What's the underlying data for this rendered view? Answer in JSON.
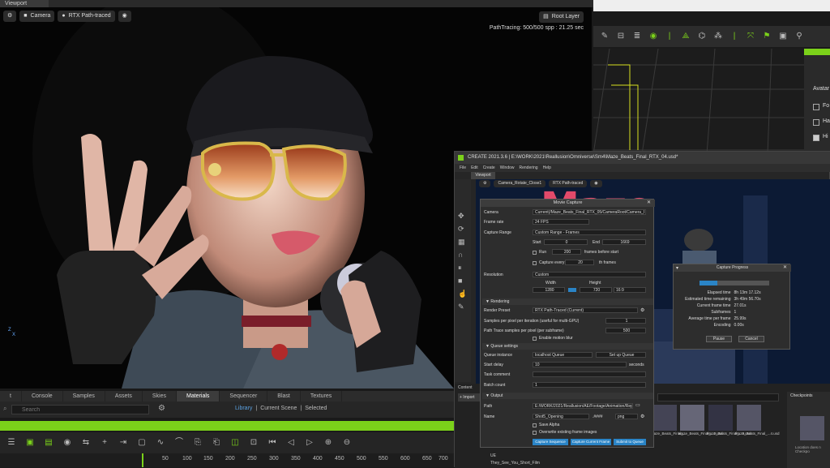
{
  "viewport": {
    "tab_label": "Viewport",
    "camera_label": "Camera",
    "render_mode": "RTX Path-traced",
    "root_layer": "Root Layer",
    "pathtracing_status": "PathTracing: 500/500 spp : 21.25 sec",
    "axis_z": "Z",
    "axis_x": "X"
  },
  "bottom_panel": {
    "tabs": [
      "t",
      "Console",
      "Samples",
      "Assets",
      "Skies",
      "Materials",
      "Sequencer",
      "Blast",
      "Textures"
    ],
    "active_tab": "Materials",
    "search_placeholder": "Search",
    "filter": [
      "Library",
      "|",
      "Current Scene",
      "|",
      "Selected"
    ],
    "ruler": [
      "0",
      "50",
      "100",
      "150",
      "200",
      "250",
      "300",
      "350",
      "400",
      "450",
      "500",
      "550",
      "600",
      "650",
      "700"
    ]
  },
  "right_panel": {
    "avatar_label": "Avatar",
    "checks": [
      "Fo",
      "Ha",
      "Hi"
    ]
  },
  "iclone": {
    "title": "CREATE  2021.3.6  |  E:\\WORK\\2021\\Reallusion\\Omniverse\\Sm4\\Maze_Beats_Final_RTX_04.usd*",
    "menu": [
      "File",
      "Edit",
      "Create",
      "Window",
      "Rendering",
      "Help"
    ],
    "viewport_tab": "Viewport",
    "camera": "Camera_Rotate_Close1",
    "render_mode": "RTX Path-traced",
    "maze_text": "Maze",
    "content_tab": "Content",
    "import": "+ Import",
    "thumbs": [
      "Maze_Beats_Final_...",
      "Maze_Beats_Final_...2.usd",
      "Maze_Beats_Final_...3.usd",
      "Maze_Beats_Final_...4.usd"
    ],
    "tree": [
      "UE",
      "They_See_You_Short_Film"
    ],
    "checkpoints": "Checkpoints",
    "checkpoint_note": "Location does n Checkpo"
  },
  "movie_capture": {
    "title": "Movie Capture",
    "camera_label": "Camera",
    "camera_value": "Current(/Maze_Beats_Final_RTX_05/CameraRoot/Camera_I",
    "framerate_label": "Frame rate",
    "framerate_value": "24 FPS",
    "range_label": "Capture Range",
    "range_value": "Custom Range - Frames",
    "start_label": "Start",
    "start_value": "0",
    "end_label": "End",
    "end_value": "1669",
    "run_label": "Run",
    "run_value": "200",
    "run_suffix": "frames before start",
    "capture_every_label": "Capture every",
    "capture_every_value": "20",
    "capture_every_suffix": "th frames",
    "resolution_label": "Resolution",
    "resolution_value": "Custom",
    "width_label": "Width",
    "height_label": "Height",
    "width_value": "1280",
    "height_value": "720",
    "aspect": "16:9",
    "rendering_header": "Rendering",
    "preset_label": "Render Preset",
    "preset_value": "RTX Path-Traced (Current)",
    "spp_label": "Samples per pixel per iteration (useful for multi-GPU)",
    "spp_value": "1",
    "pt_spp_label": "Path Trace samples per pixel (per subframe)",
    "pt_spp_value": "500",
    "motion_blur": "Enable motion blur",
    "queue_header": "Queue settings",
    "queue_instance_label": "Queue instance",
    "queue_instance_value": "localhost Queue",
    "setup_queue": "Set up Queue",
    "start_delay_label": "Start delay",
    "start_delay_value": "10",
    "seconds": "seconds",
    "task_comment_label": "Task comment",
    "batch_count_label": "Batch count",
    "batch_count_value": "1",
    "output_header": "Output",
    "path_label": "Path",
    "path_value": "E:/WORK/2021/Reallusion/AE/Footage/Animation/Rep/",
    "name_label": "Name",
    "name_value": "Shot5_Opening",
    "name_digits": ".####",
    "format": "png",
    "save_alpha": "Save Alpha",
    "overwrite": "Overwrite existing frame images",
    "btn_sequence": "Capture Sequence",
    "btn_current": "Capture Current Frame",
    "btn_queue": "Submit to Queue"
  },
  "capture_progress": {
    "title": "Capture Progress",
    "progress": 0.25,
    "rows": [
      {
        "label": "Elapsed time",
        "value": "8h 13m 17.12s"
      },
      {
        "label": "Estimated time remaining",
        "value": "3h 49m 56.70s"
      },
      {
        "label": "Current frame time",
        "value": "27.01s"
      },
      {
        "label": "Subframes",
        "value": "1"
      },
      {
        "label": "Average time per frame",
        "value": "25.99s"
      },
      {
        "label": "Encoding",
        "value": "0.00s"
      }
    ],
    "pause": "Pause",
    "cancel": "Cancel"
  },
  "colors": {
    "accent_green": "#7bd11a",
    "accent_blue": "#2a84c6"
  }
}
